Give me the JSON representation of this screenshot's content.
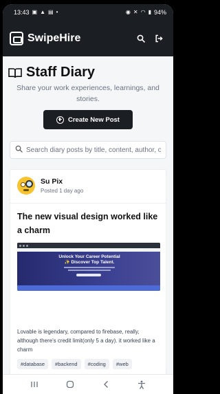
{
  "status_bar": {
    "time": "13:43",
    "battery": "94%"
  },
  "app": {
    "name": "SwipeHire"
  },
  "page": {
    "title": "Staff Diary",
    "subtitle": "Share your work experiences, learnings, and stories."
  },
  "actions": {
    "create_post_label": "Create New Post"
  },
  "search": {
    "placeholder": "Search diary posts by title, content, author, or tags..."
  },
  "post": {
    "author": "Su Pix",
    "time": "Posted 1 day ago",
    "title": "The new visual design worked like a charm",
    "image_headline": "Unlock Your Career Potential ✨ Discover Top Talent.",
    "body": "Lovable is legendary, compared to firebase, really, although there's credit limit(only 5 a day). it worked like a charm",
    "tags": [
      "#database",
      "#backend",
      "#coding",
      "#web"
    ]
  },
  "icons": {
    "search": "search-icon",
    "logout": "logout-icon",
    "book": "book-icon",
    "plus": "plus-circle-icon"
  },
  "colors": {
    "dark": "#1b1e23",
    "background": "#f5f6f8",
    "muted_text": "#6b7280"
  }
}
